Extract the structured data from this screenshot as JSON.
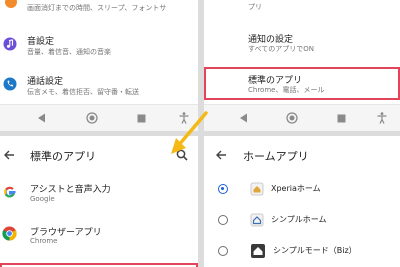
{
  "tl": {
    "item0_sub": "画面消灯までの時間、スリープ、フォントサ",
    "sound": {
      "title": "音設定",
      "sub": "音量、着信音、通知の音楽"
    },
    "call": {
      "title": "通話設定",
      "sub": "伝言メモ、着信拒否、留守番・転送"
    }
  },
  "tr": {
    "item0_sub": "プリ",
    "notify": {
      "title": "通知の設定",
      "sub": "すべてのアプリでON"
    },
    "default_apps": {
      "title": "標準のアプリ",
      "sub": "Chrome、電話、メール"
    }
  },
  "bl": {
    "title": "標準のアプリ",
    "assist": {
      "title": "アシストと音声入力",
      "sub": "Google"
    },
    "browser": {
      "title": "ブラウザーアプリ",
      "sub": "Chrome"
    }
  },
  "br": {
    "title": "ホームアプリ",
    "options": [
      {
        "label": "Xperiaホーム",
        "selected": true
      },
      {
        "label": "シンプルホーム",
        "selected": false
      },
      {
        "label": "シンプルモード（Biz）",
        "selected": false
      }
    ]
  },
  "colors": {
    "highlight": "#e0455a",
    "arrow": "#f5b916",
    "radio_selected": "#1a5fd6"
  }
}
